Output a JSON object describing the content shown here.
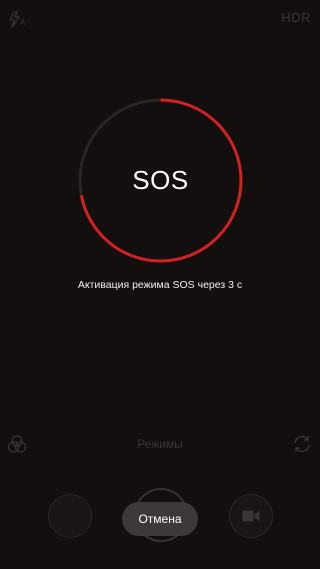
{
  "status_bar": {
    "flash_icon": "flash-auto-icon",
    "flash_label": "A",
    "hdr_label": "HDR"
  },
  "sos": {
    "label": "SOS",
    "progress": 0.72,
    "countdown_text": "Активация режима SOS через 3 с",
    "ring_color": "#d32020",
    "track_color": "#2a2524"
  },
  "camera": {
    "modes_label": "Режимы",
    "filters_icon": "filters-icon",
    "switch_icon": "switch-camera-icon",
    "video_icon": "video-camera-icon"
  },
  "cancel": {
    "label": "Отмена"
  }
}
